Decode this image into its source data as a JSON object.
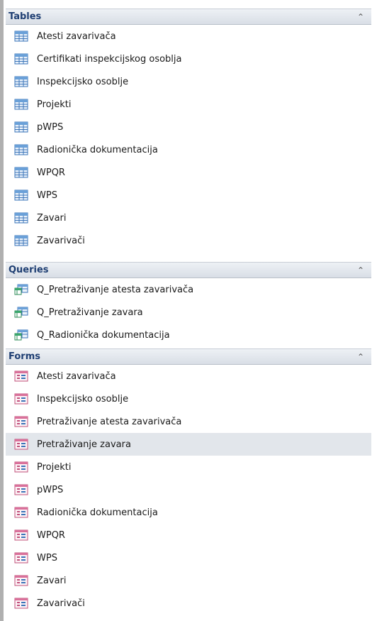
{
  "groups": [
    {
      "title": "Tables",
      "items": [
        "Atesti zavarivača",
        "Certifikati inspekcijskog osoblja",
        "Inspekcijsko osoblje",
        "Projekti",
        "pWPS",
        "Radionička dokumentacija",
        "WPQR",
        "WPS",
        "Zavari",
        "Zavarivači"
      ]
    },
    {
      "title": "Queries",
      "items": [
        "Q_Pretraživanje atesta zavarivača",
        "Q_Pretraživanje zavara",
        "Q_Radionička dokumentacija"
      ]
    },
    {
      "title": "Forms",
      "items": [
        "Atesti zavarivača",
        "Inspekcijsko osoblje",
        "Pretraživanje atesta zavarivača",
        "Pretraživanje zavara",
        "Projekti",
        "pWPS",
        "Radionička dokumentacija",
        "WPQR",
        "WPS",
        "Zavari",
        "Zavarivači"
      ]
    }
  ],
  "icons": {
    "collapse": "chevron-double-up-icon",
    "table": "table-icon",
    "query": "query-icon",
    "form": "form-icon"
  },
  "colors": {
    "header_text": "#1f3f73",
    "selected_row": "#e2e6eb"
  }
}
